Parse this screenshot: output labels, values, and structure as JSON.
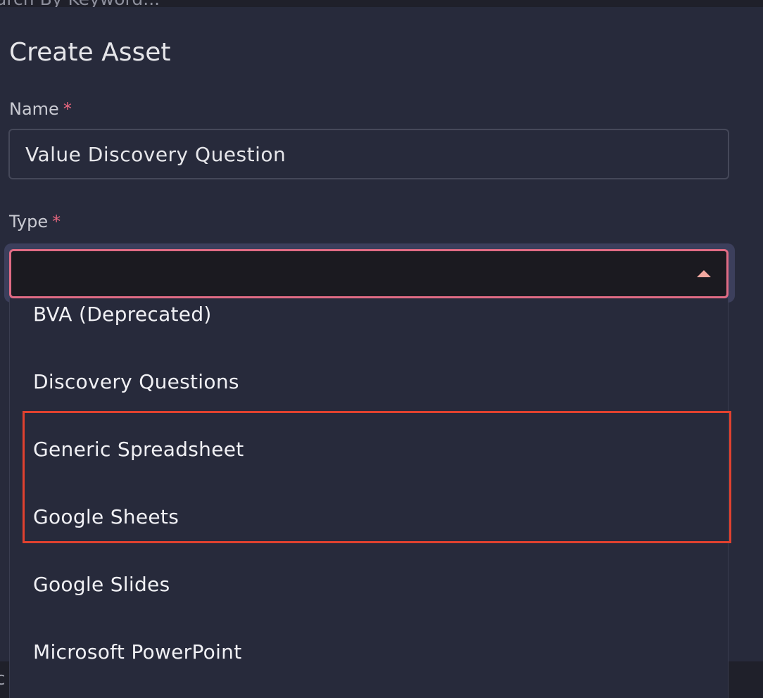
{
  "background": {
    "search_placeholder": "arch By Keyword...",
    "bottom_clip_text": "ic"
  },
  "modal": {
    "title": "Create Asset",
    "name_field": {
      "label": "Name",
      "required_mark": "*",
      "value": "Value Discovery Question"
    },
    "type_field": {
      "label": "Type",
      "required_mark": "*",
      "selected_value": "",
      "options": [
        "BVA (Deprecated)",
        "Discovery Questions",
        "Generic Spreadsheet",
        "Google Sheets",
        "Google Slides",
        "Microsoft PowerPoint"
      ]
    }
  },
  "colors": {
    "modal_bg": "#272a3b",
    "select_border": "#e06b84",
    "required_mark": "#e8677f",
    "highlight_border": "#e0412f"
  }
}
